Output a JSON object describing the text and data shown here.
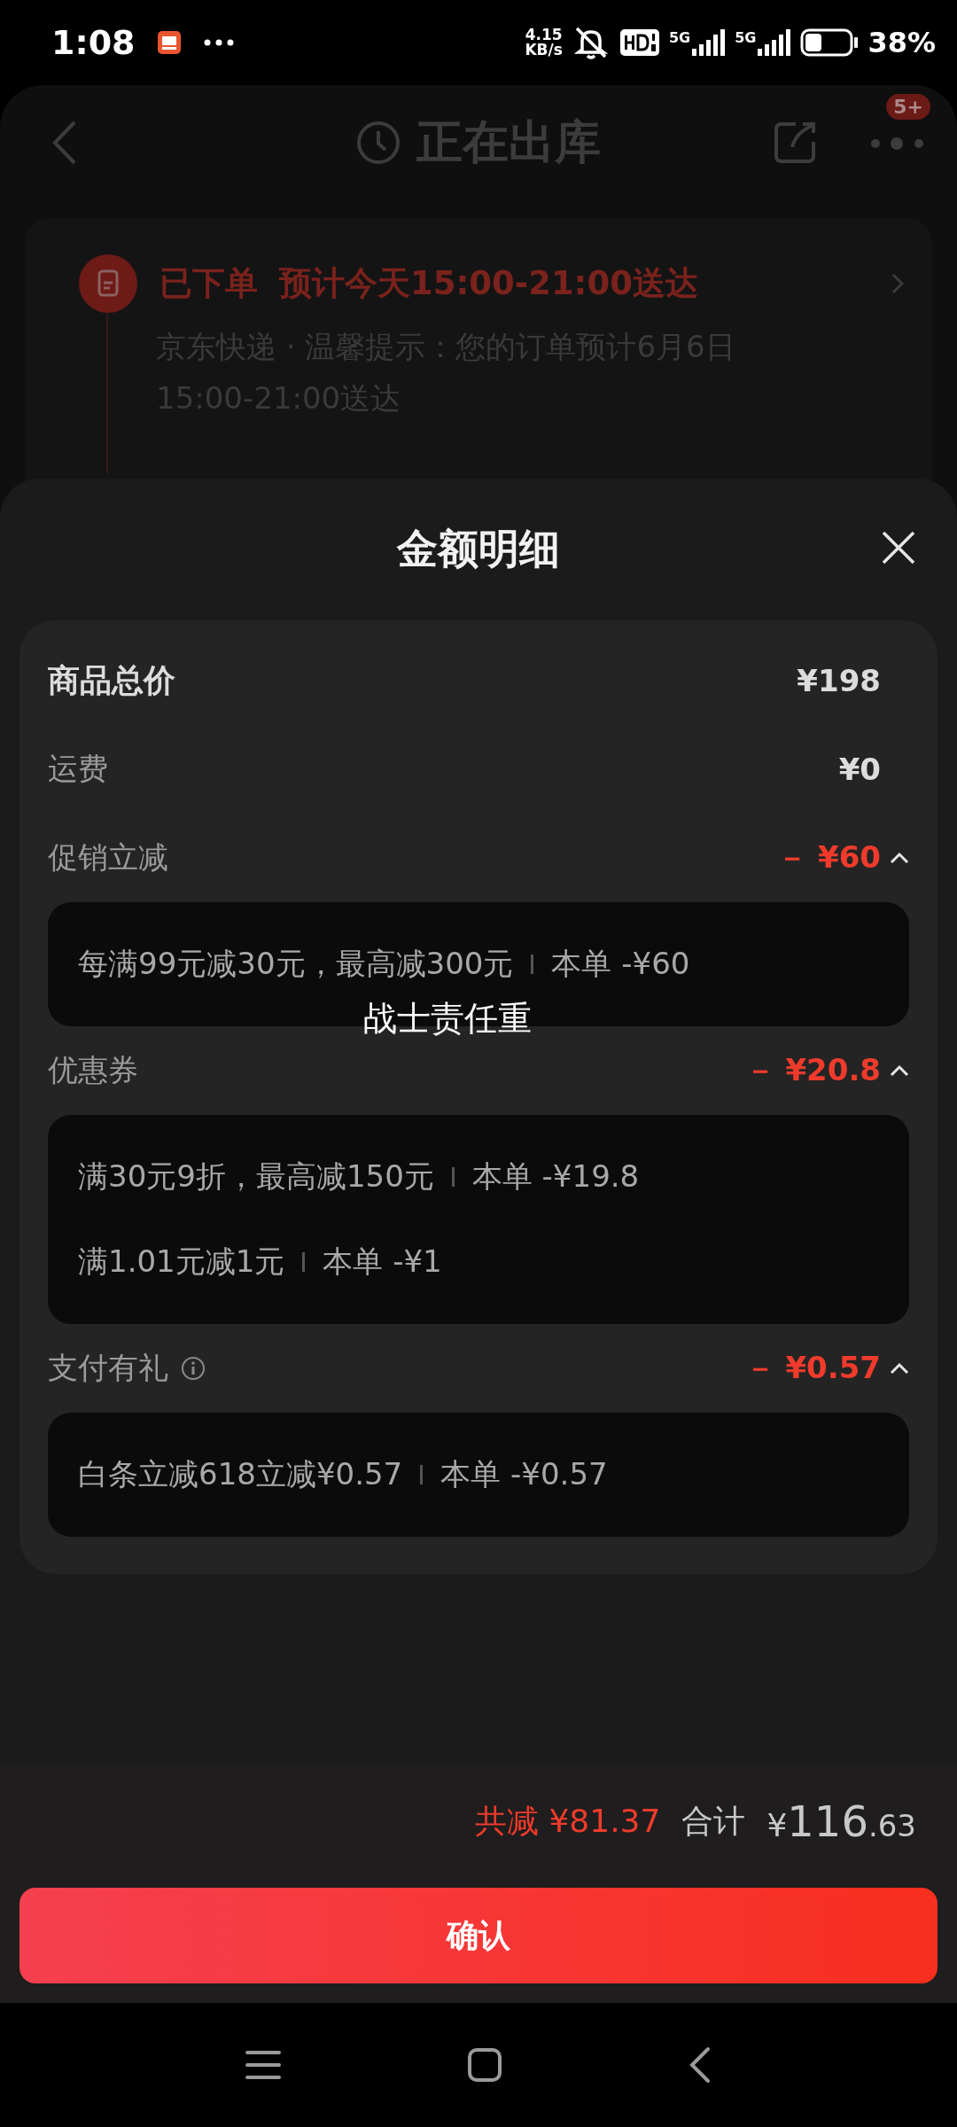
{
  "status_bar": {
    "time": "1:08",
    "net_speed": "4.15",
    "net_unit": "KB/s",
    "network_labels": [
      "5G",
      "5G"
    ],
    "battery": "38%"
  },
  "header": {
    "title": "正在出库",
    "badge": "5+"
  },
  "order_card": {
    "status": "已下单",
    "eta": "预计今天15:00-21:00送达",
    "note": "京东快递 · 温馨提示：您的订单预计6月6日15:00-21:00送达"
  },
  "sheet": {
    "title": "金额明细",
    "rows": [
      {
        "kind": "total",
        "label": "商品总价",
        "amount": "¥198"
      },
      {
        "kind": "fee",
        "label": "运费",
        "amount": "¥0"
      },
      {
        "kind": "discount",
        "label": "促销立减",
        "amount": "－ ¥60",
        "expanded": true,
        "info": false,
        "details": [
          {
            "rule": "每满99元减30元，最高减300元",
            "value": "本单 -¥60"
          }
        ]
      },
      {
        "kind": "discount",
        "label": "优惠券",
        "amount": "－ ¥20.8",
        "expanded": true,
        "info": false,
        "details": [
          {
            "rule": "满30元9折，最高减150元",
            "value": "本单 -¥19.8"
          },
          {
            "rule": "满1.01元减1元",
            "value": "本单 -¥1"
          }
        ]
      },
      {
        "kind": "discount",
        "label": "支付有礼",
        "amount": "－ ¥0.57",
        "expanded": true,
        "info": true,
        "details": [
          {
            "rule": "白条立减618立减¥0.57",
            "value": "本单 -¥0.57"
          }
        ]
      }
    ]
  },
  "caption": "战士责任重",
  "footer": {
    "saved": "共减 ¥81.37",
    "total_label": "合计",
    "total_currency": "¥",
    "total_integer": "116",
    "total_decimal": ".63",
    "confirm": "确认"
  }
}
